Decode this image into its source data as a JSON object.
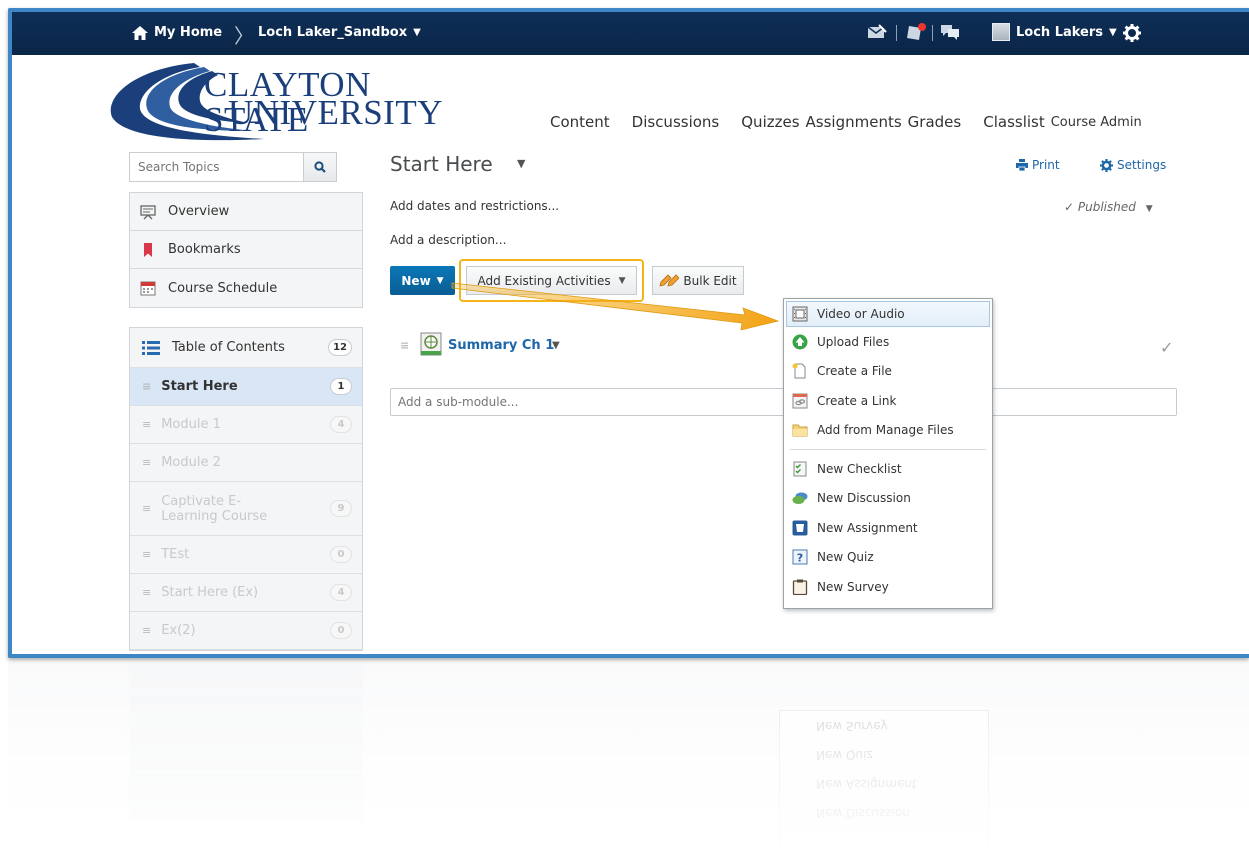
{
  "topnav": {
    "home": "My Home",
    "course": "Loch Laker_Sandbox",
    "user": "Loch Lakers"
  },
  "logo": {
    "line1": "CLAYTON STATE",
    "line2": "UNIVERSITY"
  },
  "coursenav": {
    "content": "Content",
    "discussions": "Discussions",
    "quizzes": "Quizzes",
    "assignments": "Assignments",
    "grades": "Grades",
    "classlist": "Classlist",
    "course_admin": "Course Admin"
  },
  "sidebar": {
    "search_placeholder": "Search Topics",
    "links": {
      "overview": "Overview",
      "bookmarks": "Bookmarks",
      "schedule": "Course Schedule"
    },
    "toc_label": "Table of Contents",
    "toc_count": "12",
    "modules": [
      {
        "label": "Start Here",
        "count": "1"
      },
      {
        "label": "Module 1",
        "count": "4"
      },
      {
        "label": "Module 2",
        "count": ""
      },
      {
        "label": "Captivate E-Learning Course",
        "count": "9"
      },
      {
        "label": "TEst",
        "count": "0"
      },
      {
        "label": "Start Here (Ex)",
        "count": "4"
      },
      {
        "label": "Ex(2)",
        "count": "0"
      }
    ]
  },
  "main": {
    "title": "Start Here",
    "print": "Print",
    "settings": "Settings",
    "dates": "Add dates and restrictions...",
    "published": "Published",
    "description": "Add a description...",
    "new_btn": "New",
    "add_existing": "Add Existing Activities",
    "bulk_edit": "Bulk Edit",
    "summary_title": "Summary Ch 1",
    "submodule_placeholder": "Add a sub-module..."
  },
  "menu": {
    "items": [
      "Video or Audio",
      "Upload Files",
      "Create a File",
      "Create a Link",
      "Add from Manage Files",
      "New Checklist",
      "New Discussion",
      "New Assignment",
      "New Quiz",
      "New Survey"
    ]
  },
  "colors": {
    "nav_bg": "#0f2f57",
    "accent": "#006fbf",
    "highlight": "#f5b41a",
    "frame": "#3d87c6"
  }
}
